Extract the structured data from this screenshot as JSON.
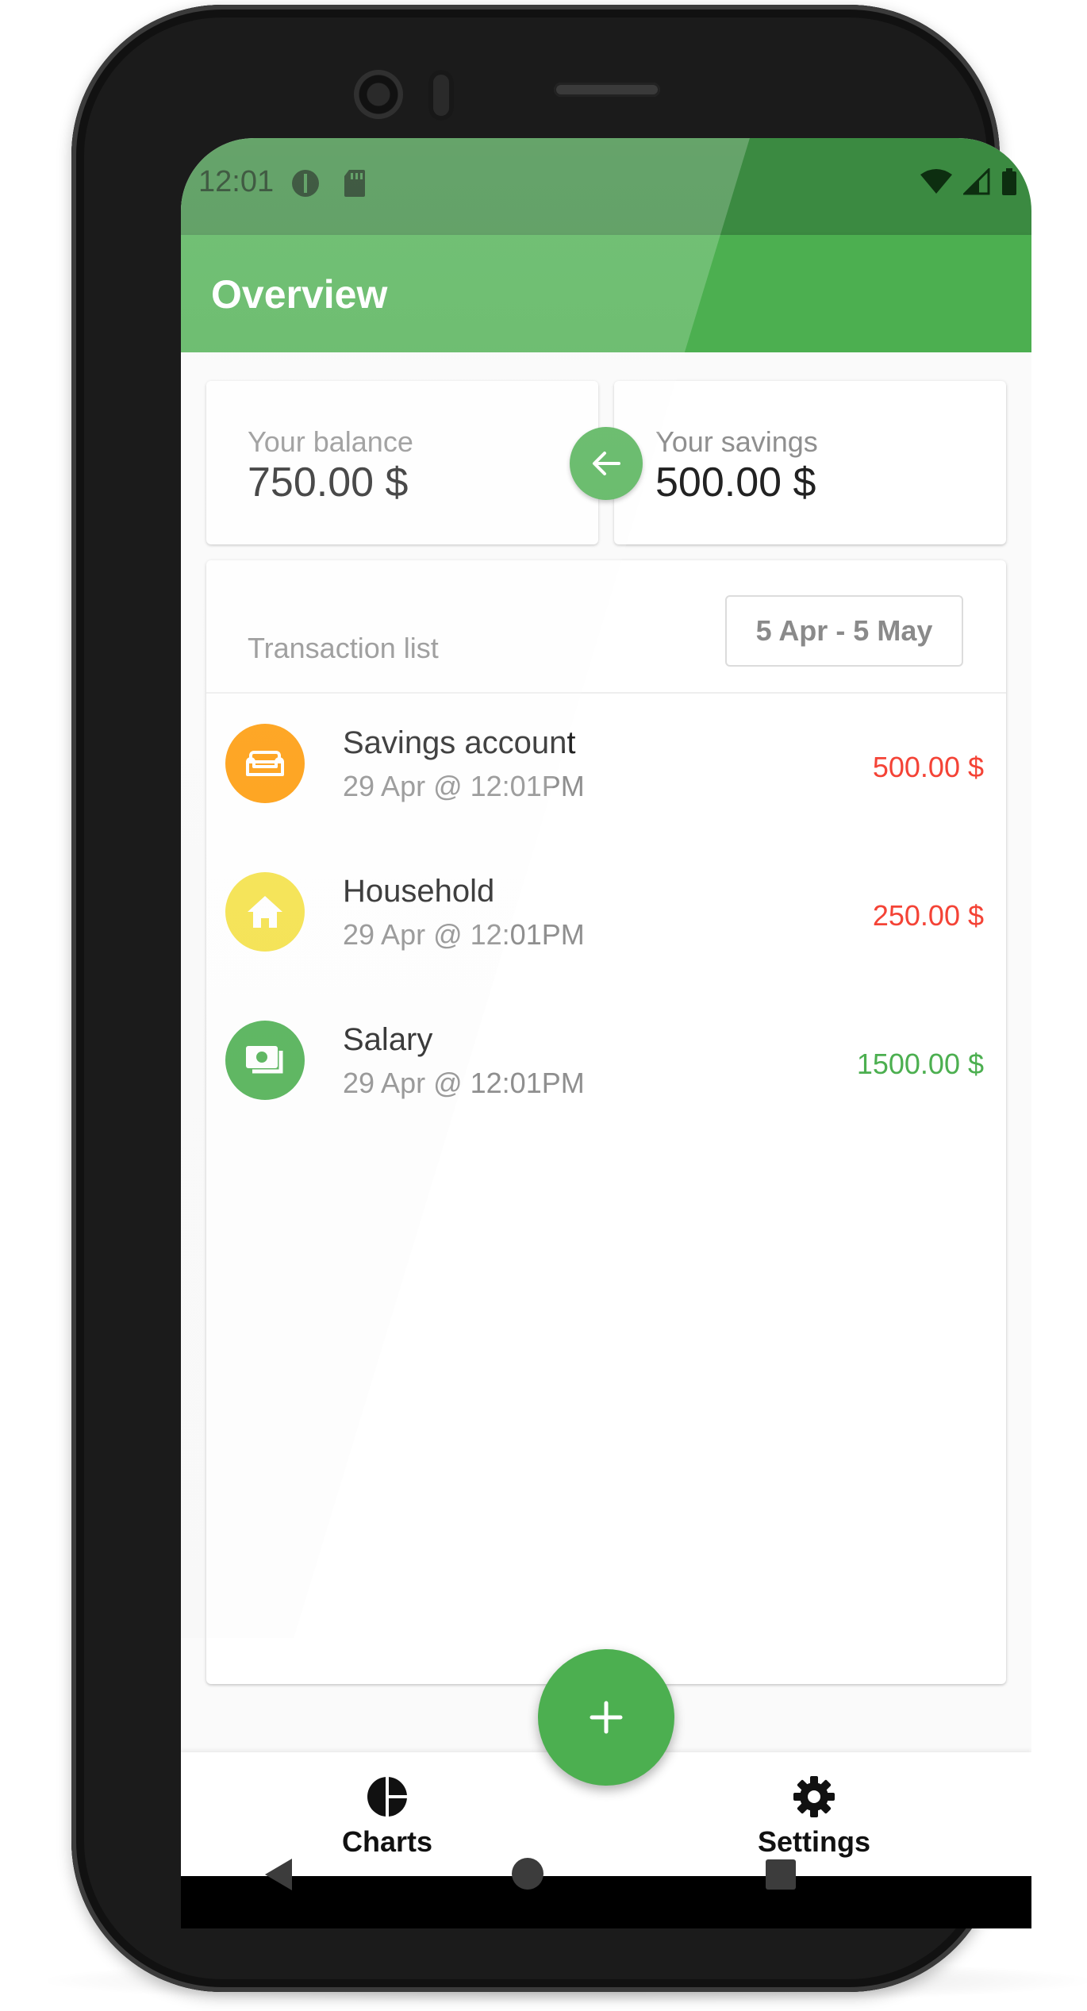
{
  "status_bar": {
    "time": "12:01"
  },
  "app_bar": {
    "title": "Overview"
  },
  "balance_card": {
    "label": "Your balance",
    "value": "750.00 $"
  },
  "savings_card": {
    "label": "Your savings",
    "value": "500.00 $"
  },
  "transaction_list": {
    "header_label": "Transaction list",
    "date_range": "5 Apr - 5 May",
    "items": [
      {
        "title": "Savings account",
        "subtitle": "29 Apr @ 12:01PM",
        "amount": "500.00 $",
        "amount_color": "#f44336",
        "icon": "sofa-icon",
        "icon_color": "#ff9800"
      },
      {
        "title": "Household",
        "subtitle": "29 Apr @ 12:01PM",
        "amount": "250.00 $",
        "amount_color": "#f44336",
        "icon": "home-icon",
        "icon_color": "#f5e142"
      },
      {
        "title": "Salary",
        "subtitle": "29 Apr @ 12:01PM",
        "amount": "1500.00 $",
        "amount_color": "#4caf50",
        "icon": "cash-icon",
        "icon_color": "#4caf50"
      }
    ]
  },
  "bottom_nav": {
    "charts_label": "Charts",
    "settings_label": "Settings"
  },
  "colors": {
    "primary": "#4caf50",
    "primary_dark": "#3b8a41",
    "expense": "#f44336",
    "income": "#4caf50"
  }
}
